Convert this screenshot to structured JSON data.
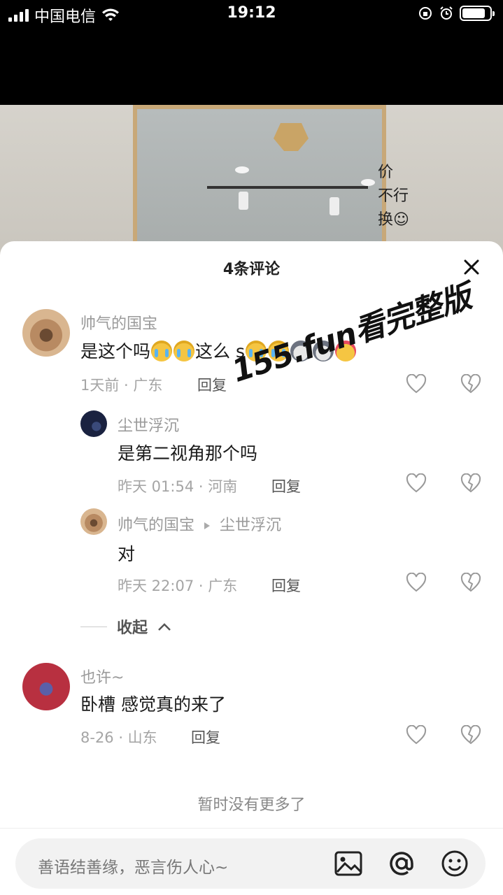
{
  "status_bar": {
    "carrier": "中国电信",
    "time": "19:12",
    "battery_level": 0.85
  },
  "video": {
    "overlay_text": [
      "价",
      "不行",
      "换☺"
    ]
  },
  "sheet": {
    "title": "4条评论",
    "comments": [
      {
        "user": "帅气的国宝",
        "text": "是这个吗",
        "text_mid": "这么 s",
        "meta": "1天前 · 广东",
        "reply": "回复"
      },
      {
        "user": "尘世浮沉",
        "text": "是第二视角那个吗",
        "meta": "昨天 01:54 · 河南",
        "reply": "回复"
      },
      {
        "user": "帅气的国宝",
        "reply_to": "尘世浮沉",
        "text": "对",
        "meta": "昨天 22:07 · 广东",
        "reply": "回复"
      },
      {
        "user": "也许~",
        "text": "卧槽 感觉真的来了",
        "meta": "8-26 · 山东",
        "reply": "回复"
      }
    ],
    "collapse_label": "收起",
    "no_more": "暂时没有更多了"
  },
  "watermark": "155.fun看完整版",
  "input": {
    "placeholder": "善语结善缘，恶言伤人心~"
  }
}
